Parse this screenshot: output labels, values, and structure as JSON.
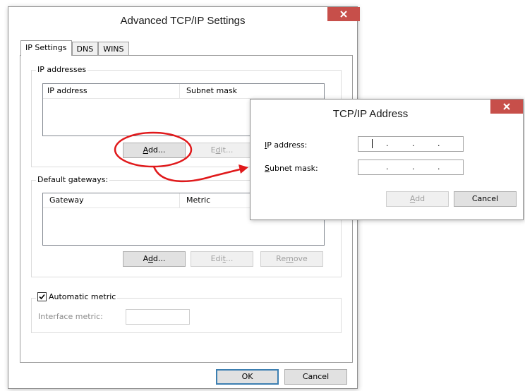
{
  "main_dialog": {
    "title": "Advanced TCP/IP Settings",
    "tabs": [
      {
        "label": "IP Settings",
        "active": true
      },
      {
        "label": "DNS",
        "active": false
      },
      {
        "label": "WINS",
        "active": false
      }
    ],
    "ip_addresses": {
      "legend": "IP addresses",
      "columns": [
        "IP address",
        "Subnet mask"
      ],
      "add_label": "Add...",
      "edit_label": "Edit..."
    },
    "default_gateways": {
      "legend": "Default gateways:",
      "columns": [
        "Gateway",
        "Metric"
      ],
      "add_label": "Add...",
      "edit_label": "Edit...",
      "remove_label": "Remove"
    },
    "automatic_metric": {
      "label": "Automatic metric",
      "checked": true,
      "interface_metric_label": "Interface metric:",
      "interface_metric_value": ""
    },
    "ok_label": "OK",
    "cancel_label": "Cancel"
  },
  "address_dialog": {
    "title": "TCP/IP Address",
    "ip_address_label": "IP address:",
    "subnet_mask_label": "Subnet mask:",
    "ip_address_value": ". . .",
    "subnet_mask_value": ". . .",
    "add_label": "Add",
    "cancel_label": "Cancel"
  },
  "colors": {
    "close_button": "#c74f4a",
    "annotation": "#e0191b",
    "primary_border": "#3c7fb1"
  },
  "icons": {
    "close": "close-icon",
    "check": "checkmark-icon"
  }
}
